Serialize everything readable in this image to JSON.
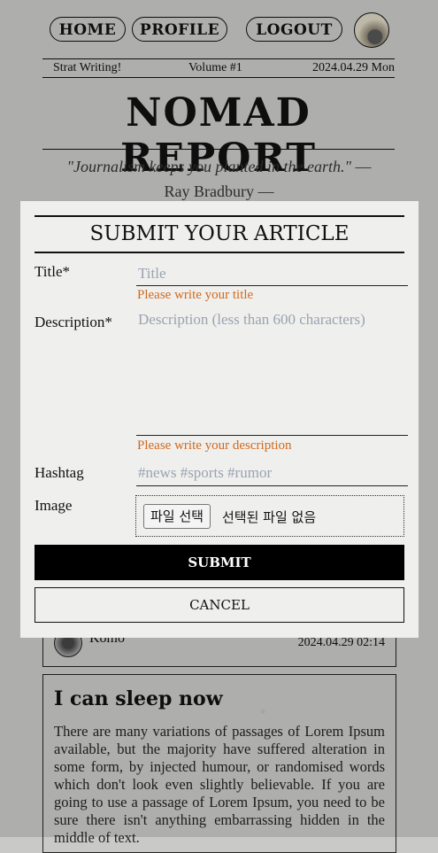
{
  "nav": {
    "home": "HOME",
    "profile": "PROFILE",
    "logout": "LOGOUT"
  },
  "dateline": {
    "left": "Strat Writing!",
    "center": "Volume #1",
    "right": "2024.04.29 Mon"
  },
  "masthead": "NOMAD REPORT",
  "quote": {
    "text": "\"Journalism keeps you planted in the earth.\"",
    "dash": "—",
    "author": "Ray Bradbury —"
  },
  "post_meta": {
    "author": "Komo",
    "datetime": "2024.04.29 02:14"
  },
  "article": {
    "title": "I can sleep now",
    "body": "There are many variations of passages of Lorem Ipsum available, but the majority have suffered alteration in some form, by injected humour, or randomised words which don't look even slightly believable. If you are going to use a passage of Lorem Ipsum, you need to be sure there isn't anything embarrassing hidden in the middle of text."
  },
  "modal": {
    "title": "SUBMIT YOUR ARTICLE",
    "title_label": "Title*",
    "title_placeholder": "Title",
    "title_error": "Please write your title",
    "description_label": "Description*",
    "description_placeholder": "Description (less than 600 characters)",
    "description_error": "Please write your description",
    "hashtag_label": "Hashtag",
    "hashtag_placeholder": "#news #sports #rumor",
    "image_label": "Image",
    "file_button": "파일 선택",
    "file_status": "선택된 파일 없음",
    "submit": "SUBMIT",
    "cancel": "CANCEL"
  },
  "colors": {
    "error": "#d2691e",
    "placeholder": "#9aa3b0",
    "submit_bg": "#000000"
  }
}
